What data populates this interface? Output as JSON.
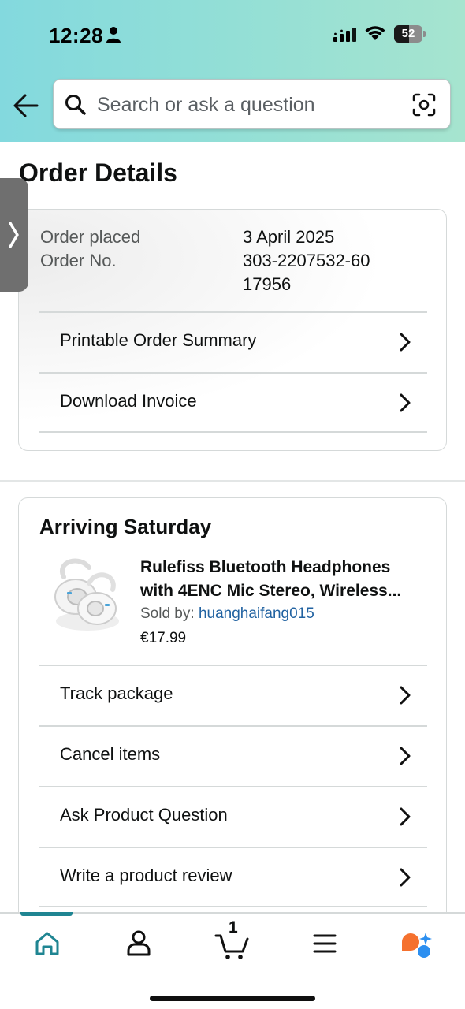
{
  "status_bar": {
    "time": "12:28",
    "battery": "52",
    "battery_level": 0.52
  },
  "header": {
    "search_placeholder": "Search or ask a question"
  },
  "page": {
    "title": "Order Details"
  },
  "order_info": {
    "placed_label": "Order placed",
    "placed_value": "3 April 2025",
    "number_label": "Order No.",
    "number_value": "303-2207532-6017956",
    "links": [
      {
        "label": "Printable Order Summary"
      },
      {
        "label": "Download Invoice"
      }
    ]
  },
  "shipment": {
    "heading": "Arriving Saturday",
    "product_title_line1": "Rulefiss Bluetooth Headphones",
    "product_title_line2": "with 4ENC Mic Stereo, Wireless...",
    "sold_by_label": "Sold by: ",
    "seller": "huanghaifang015",
    "price": "€17.99",
    "actions": [
      {
        "label": "Track package"
      },
      {
        "label": "Cancel items"
      },
      {
        "label": "Ask Product Question"
      },
      {
        "label": "Write a product review"
      }
    ]
  },
  "bottom_nav": {
    "cart_count": "1",
    "active": "home"
  },
  "colors": {
    "accent": "#1f8592",
    "link": "#2162a1",
    "header_gradient_start": "#83d9de",
    "header_gradient_end": "#a6e4cf"
  }
}
